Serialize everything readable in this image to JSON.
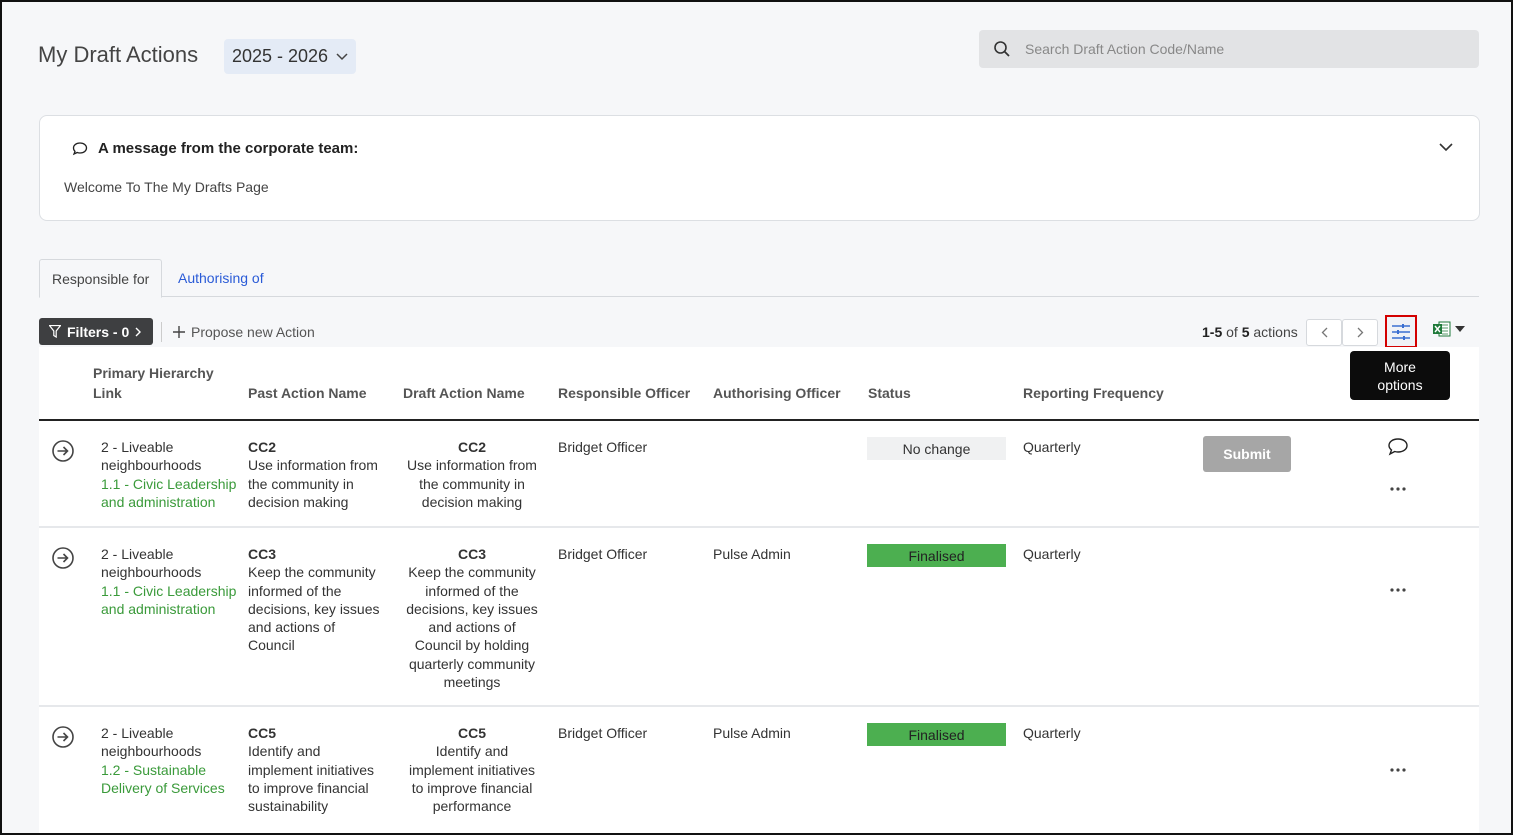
{
  "header": {
    "title": "My Draft Actions",
    "year": "2025 - 2026",
    "search_placeholder": "Search Draft Action Code/Name"
  },
  "message": {
    "heading": "A message from the corporate team:",
    "body": "Welcome To The My Drafts Page"
  },
  "tabs": [
    "Responsible for",
    "Authorising of"
  ],
  "toolbar": {
    "filters_label": "Filters - 0",
    "propose_label": "Propose new Action",
    "count_range": "1-5",
    "count_of": "of",
    "count_total": "5",
    "count_suffix": "actions",
    "tooltip_line1": "More",
    "tooltip_line2": "options"
  },
  "columns": {
    "primary_1": "Primary Hierarchy",
    "primary_2": "Link",
    "past": "Past Action Name",
    "draft": "Draft Action Name",
    "responsible": "Responsible Officer",
    "authorising": "Authorising Officer",
    "status": "Status",
    "frequency": "Reporting Frequency"
  },
  "rows": [
    {
      "hier_1": "2 - Liveable",
      "hier_2": "neighbourhoods",
      "link_1": "1.1 - Civic Leadership",
      "link_2": "and administration",
      "past_code": "CC2",
      "past_lines": [
        "Use information from",
        "the community in",
        "decision making"
      ],
      "draft_code": "CC2",
      "draft_lines": [
        "Use information from",
        "the community in",
        "decision making"
      ],
      "responsible": "Bridget Officer",
      "authorising": "",
      "status": "No change",
      "frequency": "Quarterly",
      "submit": "Submit"
    },
    {
      "hier_1": "2 - Liveable",
      "hier_2": "neighbourhoods",
      "link_1": "1.1 - Civic Leadership",
      "link_2": "and administration",
      "past_code": "CC3",
      "past_lines": [
        "Keep the community",
        "informed of the",
        "decisions, key issues",
        "and actions of",
        "Council"
      ],
      "draft_code": "CC3",
      "draft_lines": [
        "Keep the community",
        "informed of the",
        "decisions, key issues",
        "and actions of",
        "Council by holding",
        "quarterly community",
        "meetings"
      ],
      "responsible": "Bridget Officer",
      "authorising": "Pulse Admin",
      "status": "Finalised",
      "frequency": "Quarterly"
    },
    {
      "hier_1": "2 - Liveable",
      "hier_2": "neighbourhoods",
      "link_1": "1.2 - Sustainable",
      "link_2": "Delivery of Services",
      "past_code": "CC5",
      "past_lines": [
        "Identify and",
        "implement initiatives",
        "to improve financial",
        "sustainability"
      ],
      "draft_code": "CC5",
      "draft_lines": [
        "Identify and",
        "implement initiatives",
        "to improve financial",
        "performance"
      ],
      "responsible": "Bridget Officer",
      "authorising": "Pulse Admin",
      "status": "Finalised",
      "frequency": "Quarterly"
    }
  ],
  "colors": {
    "accent_link": "#2a5bd7",
    "green_link": "#3a9a3a",
    "finalised": "#4caf50",
    "highlight_box": "#d30000"
  }
}
